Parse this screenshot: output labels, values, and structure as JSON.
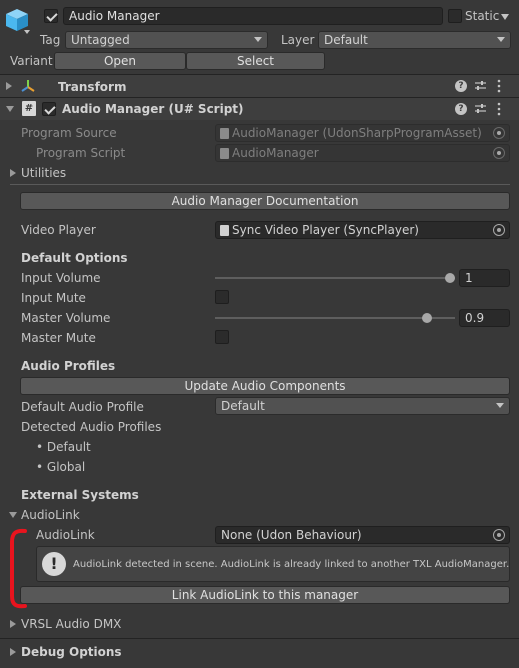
{
  "header": {
    "name": "Audio Manager",
    "static_label": "Static",
    "tag_label": "Tag",
    "tag_value": "Untagged",
    "layer_label": "Layer",
    "layer_value": "Default",
    "variant_label": "Variant",
    "open_label": "Open",
    "select_label": "Select"
  },
  "components": {
    "transform_title": "Transform",
    "script_title": "Audio Manager (U# Script)"
  },
  "script": {
    "program_source_label": "Program Source",
    "program_source_value": "AudioManager (UdonSharpProgramAsset)",
    "program_script_label": "Program Script",
    "program_script_value": "AudioManager",
    "utilities_label": "Utilities",
    "documentation_button": "Audio Manager Documentation",
    "video_player_label": "Video Player",
    "video_player_value": "Sync Video Player (SyncPlayer)"
  },
  "default_options": {
    "heading": "Default Options",
    "input_volume_label": "Input Volume",
    "input_volume_value": "1",
    "input_volume_level": 1.0,
    "input_mute_label": "Input Mute",
    "master_volume_label": "Master Volume",
    "master_volume_value": "0.9",
    "master_volume_level": 0.9,
    "master_mute_label": "Master Mute"
  },
  "audio_profiles": {
    "heading": "Audio Profiles",
    "update_button": "Update Audio Components",
    "default_profile_label": "Default Audio Profile",
    "default_profile_value": "Default",
    "detected_label": "Detected Audio Profiles",
    "detected": [
      "• Default",
      "• Global"
    ]
  },
  "external": {
    "heading": "External Systems",
    "audiolink_foldout": "AudioLink",
    "audiolink_label": "AudioLink",
    "audiolink_value": "None (Udon Behaviour)",
    "warning_text": "AudioLink detected in scene.  AudioLink is already linked to another TXL AudioManager.",
    "link_button": "Link AudioLink to this manager",
    "vrsl_foldout": "VRSL Audio DMX",
    "debug_foldout": "Debug Options"
  },
  "colors": {
    "background": "#383838",
    "annotation": "#e8141e",
    "cube_icon": "#4bb8ef"
  }
}
